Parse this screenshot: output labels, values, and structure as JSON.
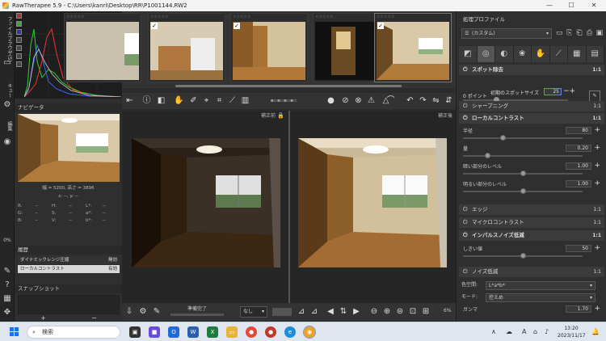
{
  "window": {
    "title": "RawTherapee 5.9 - C:\\Users\\kanri\\Desktop\\RR\\P1001144.RW2",
    "minimize": "—",
    "maximize": "☐",
    "close": "✕"
  },
  "vtabs": {
    "file_browser": "ファイルブラウザ(5)",
    "queue": "キュー",
    "edit": "編集"
  },
  "left": {
    "navigator_title": "ナビゲータ",
    "image_size": "幅 = 5200, 高さ = 3896",
    "coords": "x: --, y: --",
    "readout": [
      [
        "R:",
        "--",
        "H:",
        "--",
        "L*:",
        "--"
      ],
      [
        "G:",
        "--",
        "S:",
        "--",
        "a*:",
        "--"
      ],
      [
        "B:",
        "--",
        "V:",
        "--",
        "b*:",
        "--"
      ]
    ],
    "progress_label": "0%",
    "history_title": "履歴",
    "history": [
      {
        "name": "ダイナミックレンジ圧縮",
        "value": "無効",
        "selected": false
      },
      {
        "name": "ローカルコントラスト",
        "value": "有効",
        "selected": true
      }
    ],
    "snapshot_title": "スナップショット",
    "snap_add": "+",
    "snap_remove": "−"
  },
  "filmstrip": {
    "star_label": "☆☆☆☆☆",
    "items": [
      {
        "index": 1,
        "checked": false
      },
      {
        "index": 2,
        "checked": true
      },
      {
        "index": 3,
        "checked": true
      },
      {
        "index": 4,
        "checked": false
      },
      {
        "index": 5,
        "checked": true
      }
    ]
  },
  "viewer": {
    "before_label": "補正前",
    "after_label": "補正後"
  },
  "bottom": {
    "status": "準備完了",
    "select_value": "なし",
    "zoom": "6%"
  },
  "right": {
    "profile_title": "処理プロファイル",
    "profile_value": "(カスタム)",
    "sections": [
      {
        "id": "spot",
        "label": "スポット除去",
        "val": "1:1"
      },
      {
        "id": "sharpen",
        "label": "シャープニング",
        "val": "1:1"
      },
      {
        "id": "localcontrast",
        "label": "ローカルコントラスト",
        "val": "1:1"
      },
      {
        "id": "edge",
        "label": "エッジ",
        "val": "1:1"
      },
      {
        "id": "micro",
        "label": "マイクロコントラスト",
        "val": "1:1"
      },
      {
        "id": "impulse",
        "label": "インパルスノイズ低減",
        "val": "1:1"
      },
      {
        "id": "noise",
        "label": "ノイズ低減",
        "val": "1:1"
      }
    ],
    "spot": {
      "points": "0 ポイント",
      "size_label": "初期のスポットサイズ",
      "size_value": "25"
    },
    "local_contrast": [
      {
        "label": "半径",
        "value": "80",
        "fraction": 0.33
      },
      {
        "label": "量",
        "value": "0.20",
        "fraction": 0.2
      },
      {
        "label": "暗い部分のレベル",
        "value": "1.00",
        "fraction": 0.5
      },
      {
        "label": "明るい部分のレベル",
        "value": "1.00",
        "fraction": 0.5
      }
    ],
    "impulse": {
      "label": "しきい値",
      "value": "50",
      "fraction": 0.5
    },
    "noise": {
      "colorspace_label": "色空間:",
      "colorspace_value": "L*a*b*",
      "mode_label": "モード:",
      "mode_value": "控えめ",
      "gamma_label": "ガンマ",
      "gamma_value": "1.70"
    }
  },
  "taskbar": {
    "search": "検索",
    "time": "13:20",
    "date": "2023/11/17",
    "ime": "A"
  }
}
